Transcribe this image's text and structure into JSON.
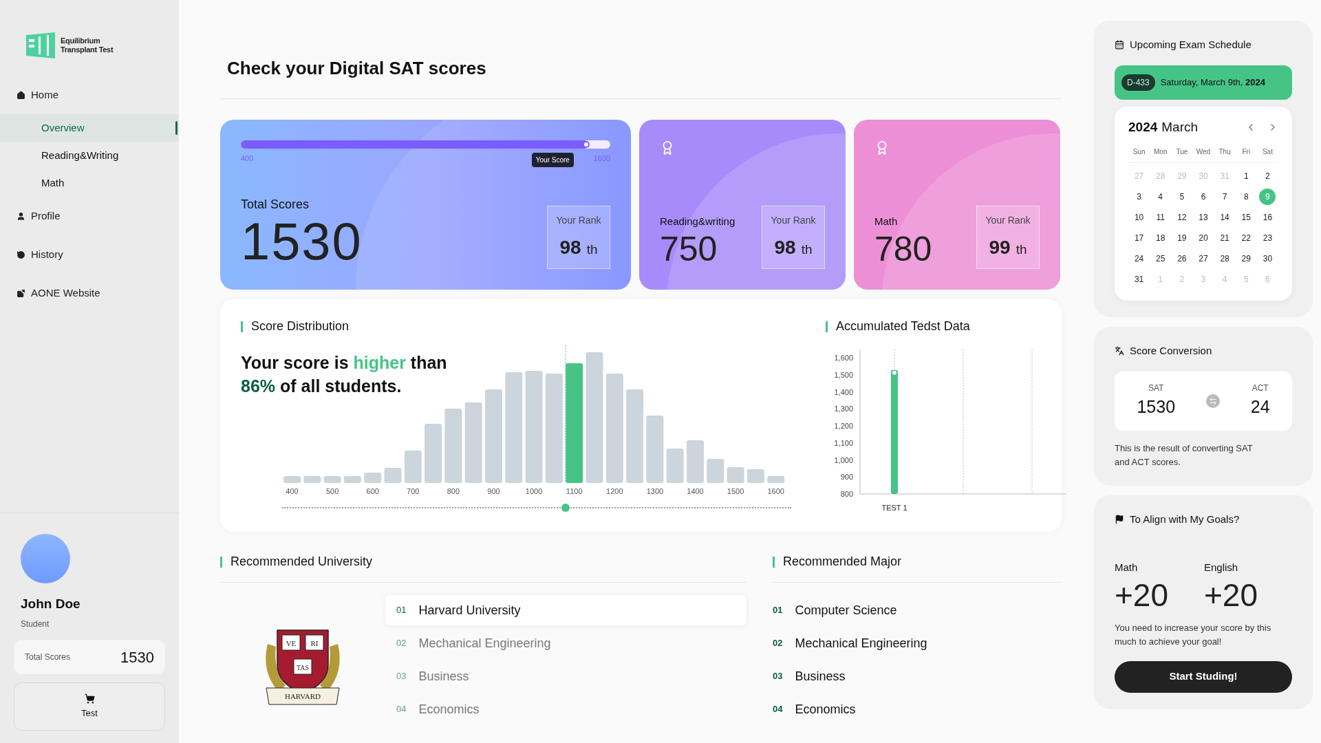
{
  "brand": {
    "line1": "Equilibrium",
    "line2": "Transplant Test"
  },
  "nav": [
    {
      "label": "Home",
      "selected": false,
      "children": [
        {
          "label": "Overview",
          "selected": true
        },
        {
          "label": "Reading&Writing",
          "selected": false
        },
        {
          "label": "Math",
          "selected": false
        }
      ]
    },
    {
      "label": "Profile",
      "selected": false
    },
    {
      "label": "History",
      "selected": false
    },
    {
      "label": "AONE Website",
      "selected": false
    }
  ],
  "user": {
    "name": "John Doe",
    "role": "Student",
    "score_label": "Total Scores",
    "score": "1530",
    "test_button": "Test"
  },
  "title": "Check your Digital SAT scores",
  "total_card": {
    "slider": {
      "min_label": "400",
      "max_label": "1600",
      "tooltip": "Your Score",
      "level": 0.94
    },
    "label": "Total Scores",
    "score": "1530",
    "rank_label": "Your Rank",
    "rank": "98",
    "rank_suffix": "th"
  },
  "section_cards": [
    {
      "label": "Reading&writing",
      "score": "750",
      "rank_label": "Your Rank",
      "rank": "98",
      "rank_suffix": "th",
      "color": "#a78bfa"
    },
    {
      "label": "Math",
      "score": "780",
      "rank_label": "Your Rank",
      "rank": "99",
      "rank_suffix": "th",
      "color": "#ec8fd6"
    }
  ],
  "distribution": {
    "title": "Score Distribution",
    "headline": "Your score is **higher** than",
    "headline2": "**86%** of all students.",
    "x_labels": [
      "400",
      "500",
      "600",
      "700",
      "800",
      "900",
      "1000",
      "1100",
      "1200",
      "1300",
      "1400",
      "1500",
      "1600"
    ]
  },
  "accumulated": {
    "title": "Accumulated Tedst Data",
    "chart_data": {
      "type": "bar",
      "categories": [
        "TEST 1"
      ],
      "series": [
        {
          "color": "#45c486",
          "values": [
            1530
          ]
        }
      ],
      "ylim": [
        800,
        1650
      ],
      "yticks": [
        {
          "value": 800,
          "label": "800"
        },
        {
          "value": 900,
          "label": "900"
        },
        {
          "value": 1000,
          "label": "1,000"
        },
        {
          "value": 1100,
          "label": "1,100"
        },
        {
          "value": 1200,
          "label": "1,200"
        },
        {
          "value": 1300,
          "label": "1,300"
        },
        {
          "value": 1400,
          "label": "1,400"
        },
        {
          "value": 1500,
          "label": "1,500"
        },
        {
          "value": 1600,
          "label": "1,600"
        }
      ]
    }
  },
  "university": {
    "title": "Recommended University",
    "crest": {
      "top_left": "VE",
      "top_right": "RI",
      "bottom": "TAS",
      "ribbon": "HARVARD"
    },
    "items": [
      {
        "num": "01",
        "label": "Harvard University",
        "selected": true
      },
      {
        "num": "02",
        "label": "Mechanical Engineering",
        "selected": false
      },
      {
        "num": "03",
        "label": "Business",
        "selected": false
      },
      {
        "num": "04",
        "label": "Economics",
        "selected": false
      }
    ]
  },
  "major": {
    "title": "Recommended Major",
    "items": [
      {
        "num": "01",
        "label": "Computer Science"
      },
      {
        "num": "02",
        "label": "Mechanical Engineering"
      },
      {
        "num": "03",
        "label": "Business"
      },
      {
        "num": "04",
        "label": "Economics"
      }
    ]
  },
  "schedule": {
    "title": "Upcoming Exam Schedule",
    "dday": "D-433",
    "date": "Saturday, March 9th, **2024**",
    "cal_year": "2024",
    "cal_month": "March",
    "weekdays": [
      "Sun",
      "Mon",
      "Tue",
      "Wed",
      "Thu",
      "Fri",
      "Sat"
    ],
    "weeks": [
      [
        {
          "d": "27",
          "muted": true,
          "selected": false
        },
        {
          "d": "28",
          "muted": true,
          "selected": false
        },
        {
          "d": "29",
          "muted": true,
          "selected": false
        },
        {
          "d": "30",
          "muted": true,
          "selected": false
        },
        {
          "d": "31",
          "muted": true,
          "selected": false
        },
        {
          "d": "1",
          "muted": false,
          "selected": false
        },
        {
          "d": "2",
          "muted": false,
          "selected": false
        }
      ],
      [
        {
          "d": "3",
          "muted": false,
          "selected": false
        },
        {
          "d": "4",
          "muted": false,
          "selected": false
        },
        {
          "d": "5",
          "muted": false,
          "selected": false
        },
        {
          "d": "6",
          "muted": false,
          "selected": false
        },
        {
          "d": "7",
          "muted": false,
          "selected": false
        },
        {
          "d": "8",
          "muted": false,
          "selected": false
        },
        {
          "d": "9",
          "muted": false,
          "selected": true
        }
      ],
      [
        {
          "d": "10",
          "muted": false,
          "selected": false
        },
        {
          "d": "11",
          "muted": false,
          "selected": false
        },
        {
          "d": "12",
          "muted": false,
          "selected": false
        },
        {
          "d": "13",
          "muted": false,
          "selected": false
        },
        {
          "d": "14",
          "muted": false,
          "selected": false
        },
        {
          "d": "15",
          "muted": false,
          "selected": false
        },
        {
          "d": "16",
          "muted": false,
          "selected": false
        }
      ],
      [
        {
          "d": "17",
          "muted": false,
          "selected": false
        },
        {
          "d": "18",
          "muted": false,
          "selected": false
        },
        {
          "d": "19",
          "muted": false,
          "selected": false
        },
        {
          "d": "20",
          "muted": false,
          "selected": false
        },
        {
          "d": "21",
          "muted": false,
          "selected": false
        },
        {
          "d": "22",
          "muted": false,
          "selected": false
        },
        {
          "d": "23",
          "muted": false,
          "selected": false
        }
      ],
      [
        {
          "d": "24",
          "muted": false,
          "selected": false
        },
        {
          "d": "25",
          "muted": false,
          "selected": false
        },
        {
          "d": "26",
          "muted": false,
          "selected": false
        },
        {
          "d": "27",
          "muted": false,
          "selected": false
        },
        {
          "d": "28",
          "muted": false,
          "selected": false
        },
        {
          "d": "29",
          "muted": false,
          "selected": false
        },
        {
          "d": "30",
          "muted": false,
          "selected": false
        }
      ],
      [
        {
          "d": "31",
          "muted": false,
          "selected": false
        },
        {
          "d": "1",
          "muted": true,
          "selected": false
        },
        {
          "d": "2",
          "muted": true,
          "selected": false
        },
        {
          "d": "3",
          "muted": true,
          "selected": false
        },
        {
          "d": "4",
          "muted": true,
          "selected": false
        },
        {
          "d": "5",
          "muted": true,
          "selected": false
        },
        {
          "d": "6",
          "muted": true,
          "selected": false
        }
      ]
    ]
  },
  "conversion": {
    "title": "Score Conversion",
    "left_label": "SAT",
    "left_value": "1530",
    "right_label": "ACT",
    "right_value": "24",
    "note": "This is the result of converting SAT and ACT scores."
  },
  "goals": {
    "title": "To Align with My Goals?",
    "items": [
      {
        "label": "Math",
        "value": "+20"
      },
      {
        "label": "English",
        "value": "+20"
      }
    ],
    "note": "You need to increase your score by this much to achieve your goal!",
    "button": "Start Studing!"
  }
}
